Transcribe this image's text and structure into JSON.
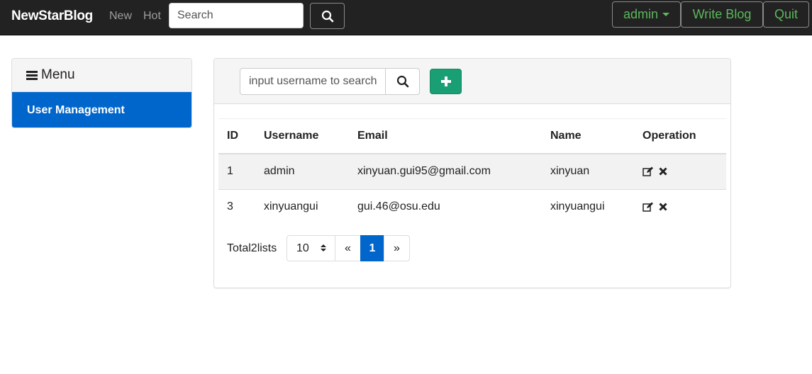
{
  "navbar": {
    "brand": "NewStarBlog",
    "links": [
      "New",
      "Hot"
    ],
    "search_placeholder": "Search",
    "search_icon": "search-icon",
    "user_menu_label": "admin",
    "write_blog_label": "Write Blog",
    "quit_label": "Quit"
  },
  "sidebar": {
    "heading": "Menu",
    "items": [
      {
        "label": "User Management",
        "active": true
      }
    ]
  },
  "main": {
    "search_placeholder": "input username to search",
    "add_icon": "plus-icon",
    "table": {
      "headers": [
        "ID",
        "Username",
        "Email",
        "Name",
        "Operation"
      ],
      "rows": [
        [
          "1",
          "admin",
          "xinyuan.gui95@gmail.com",
          "xinyuan"
        ],
        [
          "3",
          "xinyuangui",
          "gui.46@osu.edu",
          "xinyuangui"
        ]
      ],
      "operation_icons": [
        "edit-icon",
        "delete-icon"
      ]
    },
    "pagination": {
      "total_text": "Total2lists",
      "page_size": "10",
      "prev": "«",
      "current_page": "1",
      "next": "»"
    }
  },
  "colors": {
    "navbar_bg": "#222222",
    "accent_green": "#5cb85c",
    "primary_blue": "#0066cc",
    "add_button": "#1a9e73"
  }
}
